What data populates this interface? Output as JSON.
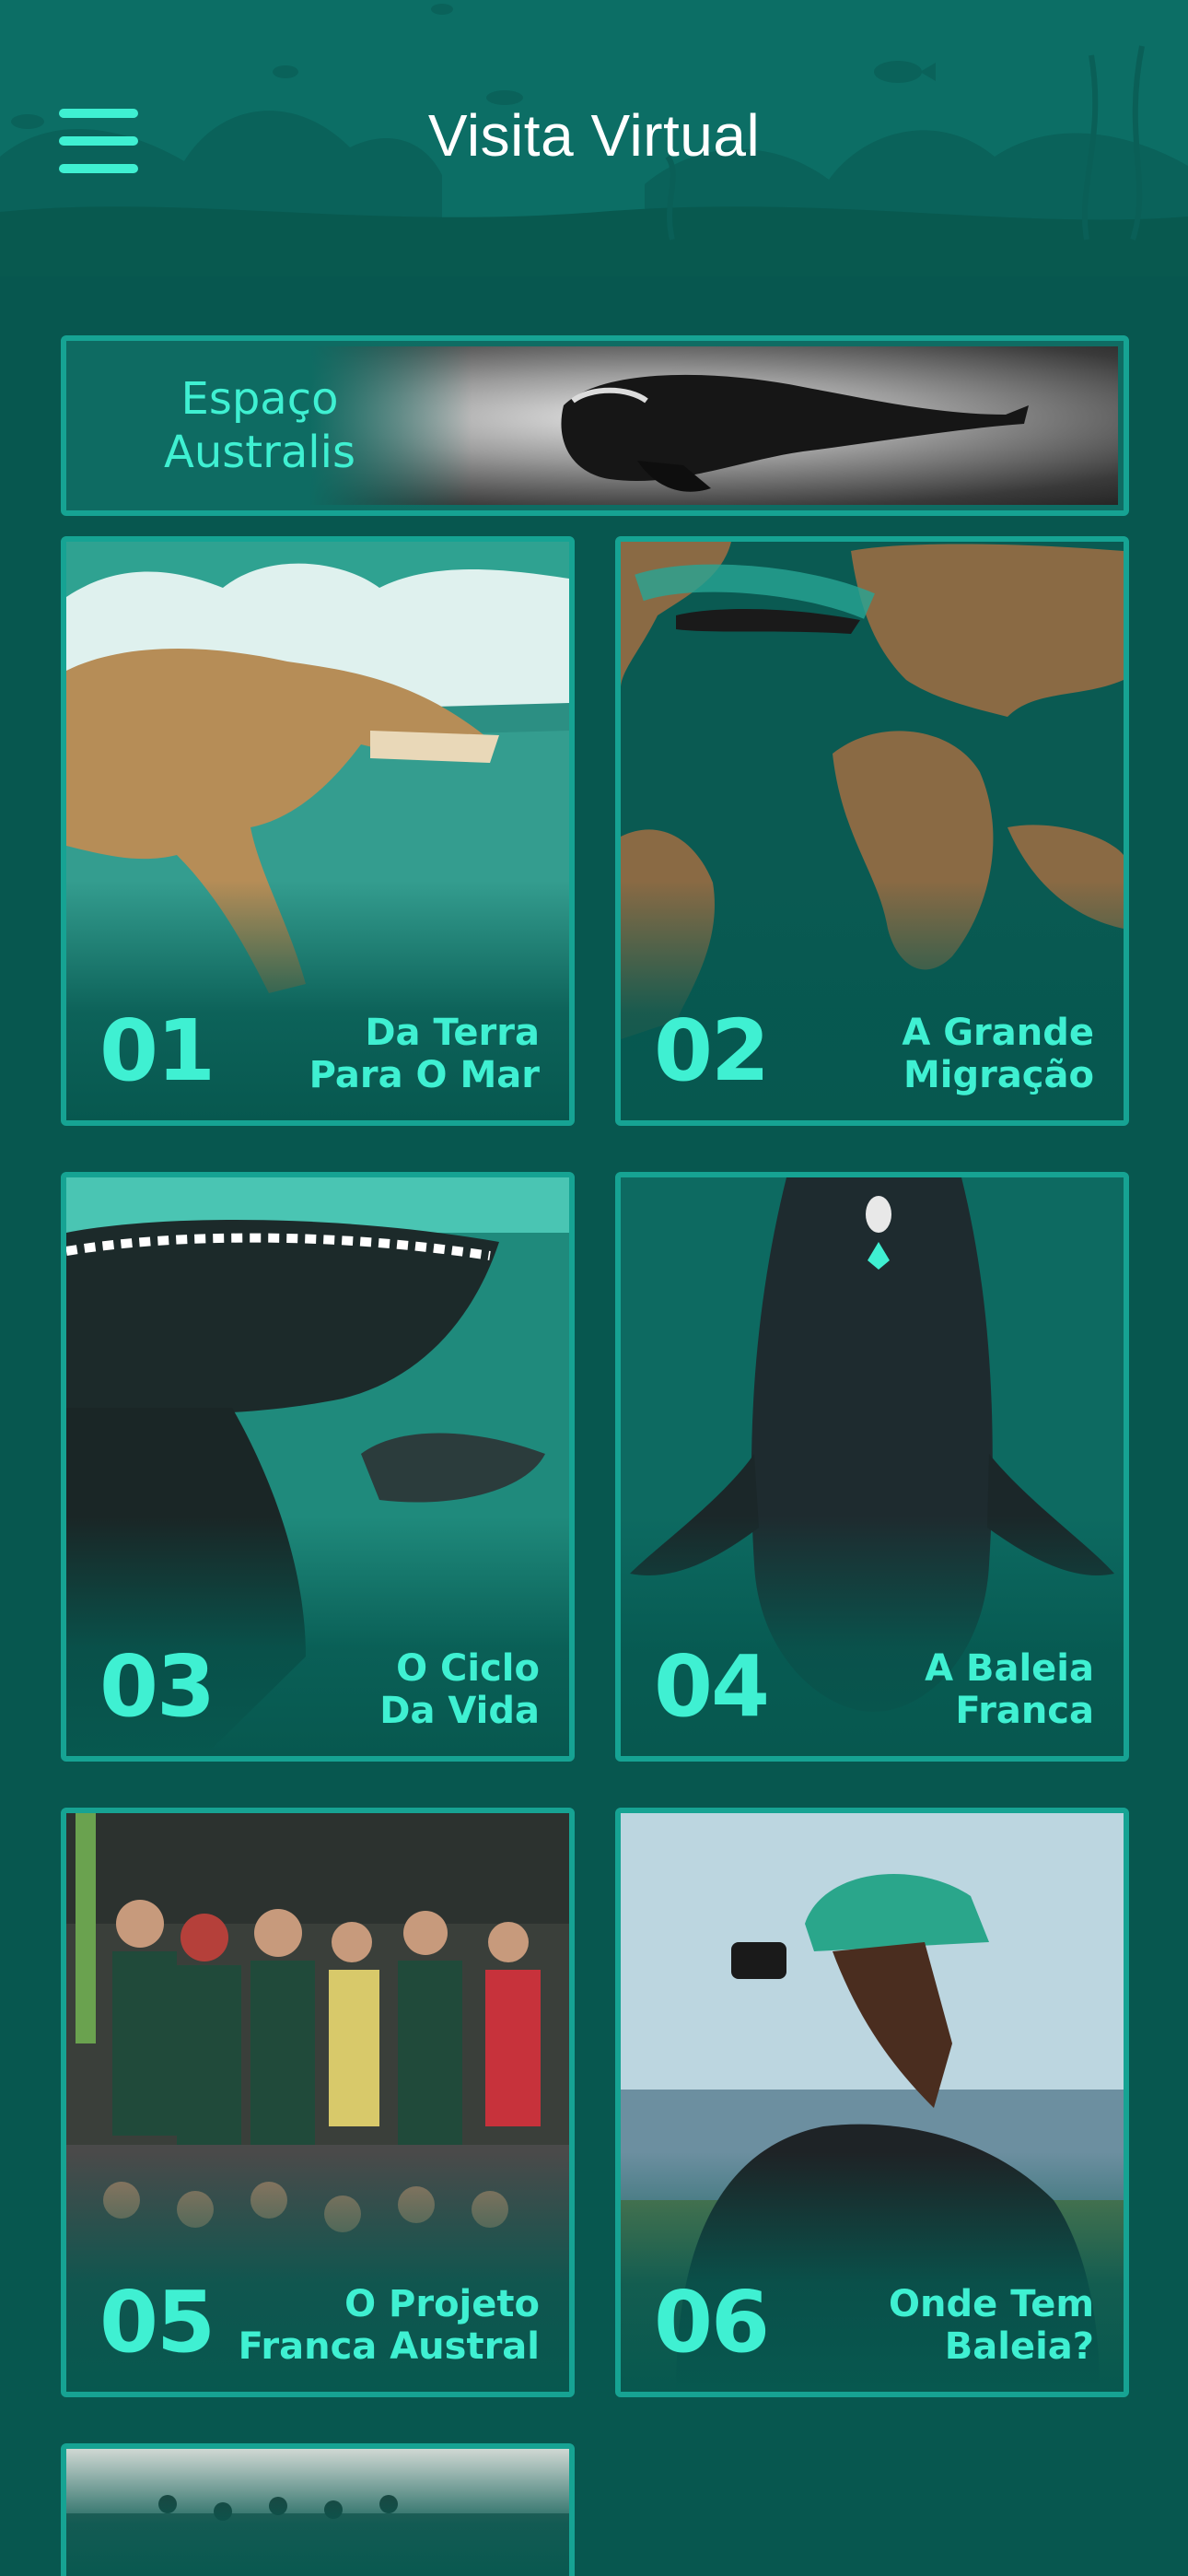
{
  "header": {
    "title": "Visita Virtual",
    "menu_icon": "hamburger-menu-icon"
  },
  "banner": {
    "label": "Espaço Australis"
  },
  "cards": [
    {
      "number": "01",
      "label_line1": "Da Terra",
      "label_line2": "Para O Mar"
    },
    {
      "number": "02",
      "label_line1": "A Grande",
      "label_line2": "Migração"
    },
    {
      "number": "03",
      "label_line1": "O Ciclo",
      "label_line2": "Da Vida"
    },
    {
      "number": "04",
      "label_line1": "A Baleia",
      "label_line2": "Franca"
    },
    {
      "number": "05",
      "label_line1": "O Projeto",
      "label_line2": "Franca Austral"
    },
    {
      "number": "06",
      "label_line1": "Onde Tem",
      "label_line2": "Baleia?"
    }
  ],
  "colors": {
    "background": "#07574f",
    "accent": "#3ff0d2",
    "border": "#16a393"
  }
}
